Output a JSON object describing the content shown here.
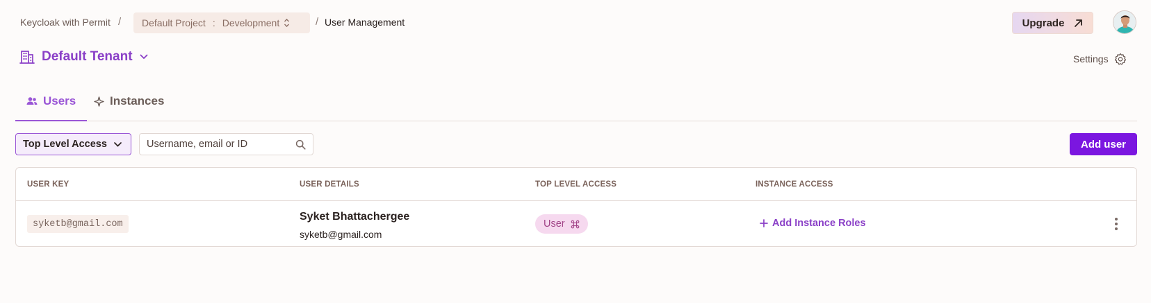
{
  "breadcrumb": {
    "org": "Keycloak with Permit",
    "separator": "/",
    "project": "Default Project",
    "env_separator": ":",
    "environment": "Development",
    "page": "User Management"
  },
  "header": {
    "upgrade_label": "Upgrade",
    "settings_label": "Settings",
    "tenant_label": "Default Tenant"
  },
  "tabs": [
    {
      "label": "Users",
      "active": true
    },
    {
      "label": "Instances",
      "active": false
    }
  ],
  "toolbar": {
    "filter_label": "Top Level Access",
    "search_placeholder": "Username, email or ID",
    "add_user_label": "Add user"
  },
  "table": {
    "columns": [
      "USER KEY",
      "USER DETAILS",
      "TOP LEVEL ACCESS",
      "INSTANCE ACCESS"
    ],
    "rows": [
      {
        "user_key": "syketb@gmail.com",
        "name": "Syket Bhattachergee",
        "email": "syketb@gmail.com",
        "role": "User",
        "instance_action": "Add Instance Roles"
      }
    ]
  },
  "colors": {
    "accent": "#9a56d6",
    "primary_button": "#7b16e0",
    "role_chip_bg": "#f6d9ef",
    "role_chip_text": "#a24488"
  }
}
